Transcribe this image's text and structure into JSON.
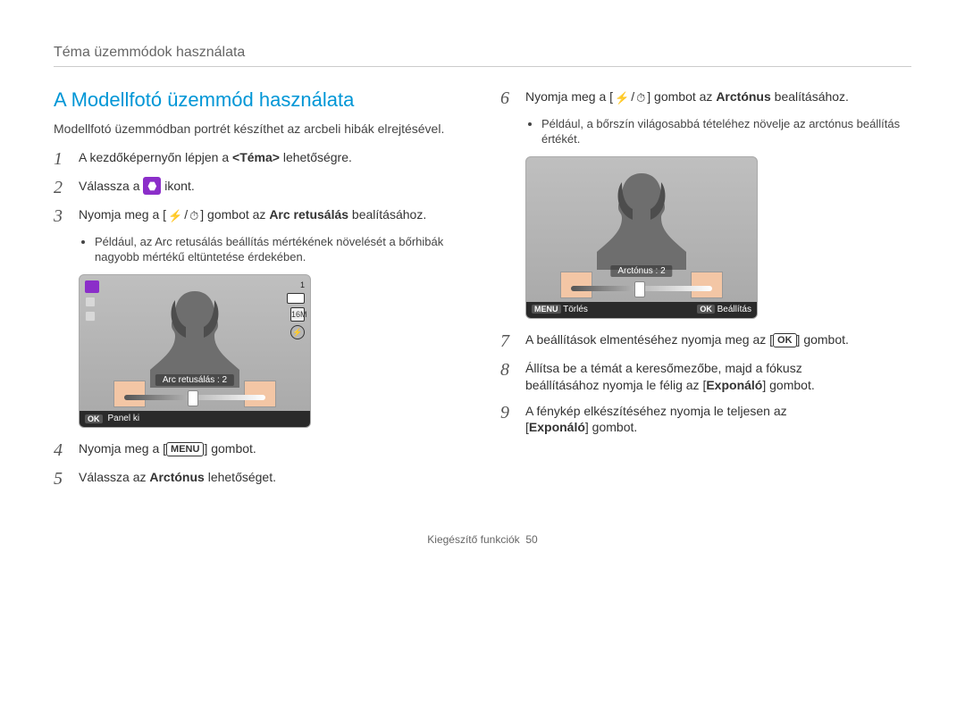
{
  "breadcrumb": "Téma üzemmódok használata",
  "section_title": "A Modellfotó üzemmód használata",
  "intro": "Modellfotó üzemmódban portrét készíthet az arcbeli hibák elrejtésével.",
  "left_steps": {
    "s1": {
      "num": "1",
      "prefix": "A kezdőképernyőn lépjen a ",
      "bold": "<Téma>",
      "suffix": " lehetőségre."
    },
    "s2": {
      "num": "2",
      "prefix": "Válassza a ",
      "suffix": " ikont."
    },
    "s3": {
      "num": "3",
      "prefix": "Nyomja meg a [",
      "mid": "] gombot az ",
      "bold": "Arc retusálás",
      "suffix": " bealításához.",
      "note": "Például, az Arc retusálás beállítás mértékének növelését a bőrhibák nagyobb mértékű eltüntetése érdekében."
    },
    "s4": {
      "num": "4",
      "prefix": "Nyomja meg a [",
      "menu": "MENU",
      "suffix": "] gombot."
    },
    "s5": {
      "num": "5",
      "prefix": "Válassza az ",
      "bold": "Arctónus",
      "suffix": " lehetőséget."
    }
  },
  "right_steps": {
    "s6": {
      "num": "6",
      "prefix": "Nyomja meg a [",
      "mid": "] gombot az ",
      "bold": "Arctónus",
      "suffix": " bealításához.",
      "note": "Például, a bőrszín világosabbá tételéhez növelje az arctónus beállítás értékét."
    },
    "s7": {
      "num": "7",
      "prefix": "A beállítások elmentéséhez nyomja meg az [",
      "ok": "OK",
      "suffix": "] gombot."
    },
    "s8": {
      "num": "8",
      "line1": "Állítsa be a témát a keresőmezőbe, majd a fókusz",
      "line2_prefix": "beállításához nyomja le félig az [",
      "bold": "Exponáló",
      "line2_suffix": "] gombot."
    },
    "s9": {
      "num": "9",
      "line1": "A fénykép elkészítéséhez nyomja le teljesen az",
      "line2_prefix": "[",
      "bold": "Exponáló",
      "line2_suffix": "] gombot."
    }
  },
  "cam1": {
    "chip_label": "Arc retusálás : 2",
    "footer_ok": "OK",
    "footer_text": "Panel ki",
    "counter": "1",
    "card": "16M"
  },
  "cam2": {
    "chip_label": "Arctónus : 2",
    "footer_menu": "MENU",
    "footer_menu_text": "Törlés",
    "footer_ok": "OK",
    "footer_ok_text": "Beállítás"
  },
  "glyphs": {
    "flash": "⚡",
    "timer": "⏱"
  },
  "footer": {
    "section": "Kiegészítő funkciók",
    "page": "50"
  }
}
